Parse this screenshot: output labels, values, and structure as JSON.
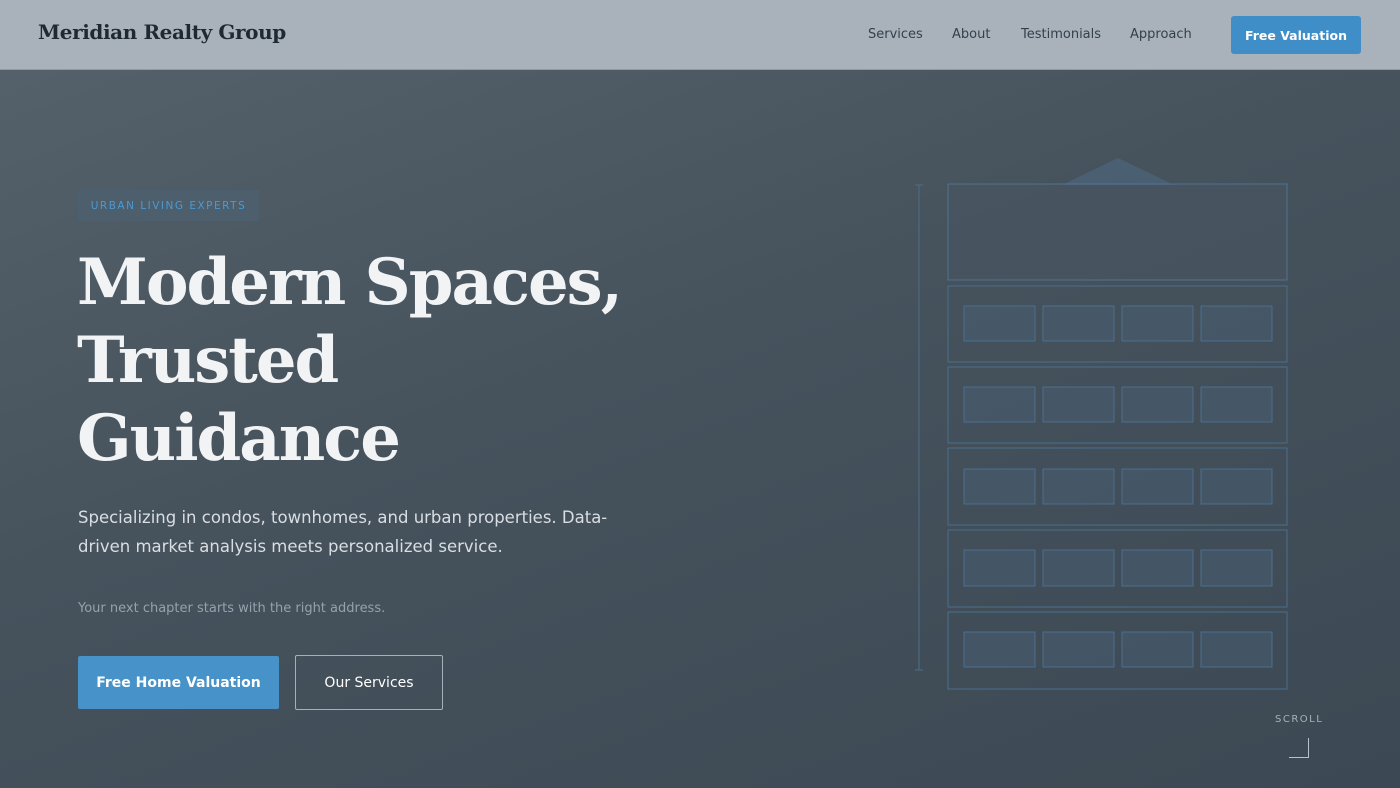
{
  "header": {
    "brand": "Meridian Realty Group",
    "nav": [
      "Services",
      "About",
      "Testimonials",
      "Approach"
    ],
    "cta": "Free Valuation"
  },
  "hero": {
    "eyebrow": "URBAN LIVING EXPERTS",
    "headline": [
      "Modern Spaces,",
      "Trusted",
      "Guidance"
    ],
    "subtitle": "Specializing in condos, townhomes, and urban properties. Data-driven market analysis meets personalized service.",
    "tagline": "Your next chapter starts with the right address.",
    "primary_cta": "Free Home Valuation",
    "secondary_cta": "Our Services"
  },
  "scroll": {
    "label": "SCROLL",
    "icon": "scroll-down-corner-icon"
  },
  "illustration": {
    "icon": "building-outline-icon"
  },
  "colors": {
    "accent": "#4792c9",
    "header_bg": "#a9b2bb",
    "hero_bg": "#46525c",
    "eyebrow_text": "#4a9ad3"
  }
}
